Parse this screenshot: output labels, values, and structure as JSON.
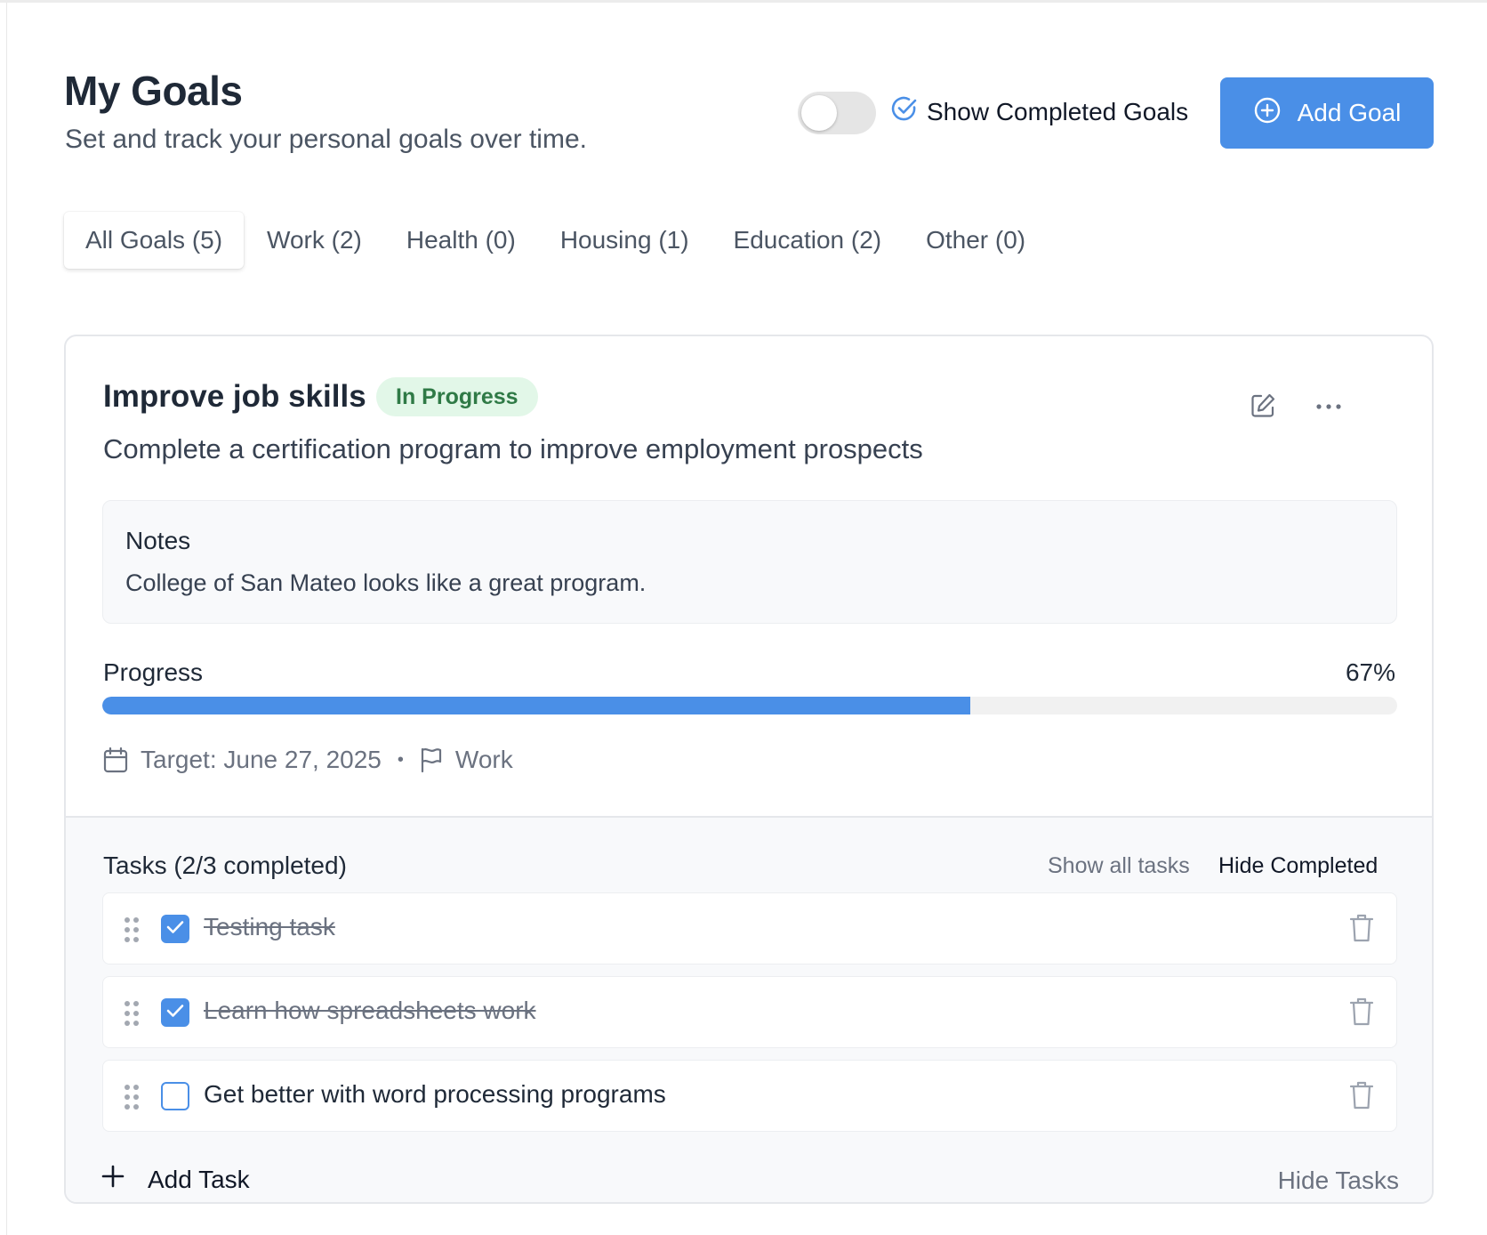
{
  "header": {
    "title": "My Goals",
    "subtitle": "Set and track your personal goals over time.",
    "toggle_on": false,
    "show_completed_label": "Show Completed Goals",
    "add_goal_label": "Add Goal"
  },
  "tabs": [
    {
      "label": "All Goals (5)",
      "active": true
    },
    {
      "label": "Work (2)",
      "active": false
    },
    {
      "label": "Health (0)",
      "active": false
    },
    {
      "label": "Housing (1)",
      "active": false
    },
    {
      "label": "Education (2)",
      "active": false
    },
    {
      "label": "Other (0)",
      "active": false
    }
  ],
  "goal": {
    "title": "Improve job skills",
    "status": "In Progress",
    "description": "Complete a certification program to improve employment prospects",
    "notes_label": "Notes",
    "notes_text": "College of San Mateo looks like a great program.",
    "progress_label": "Progress",
    "progress_text": "67%",
    "progress_fraction": 0.67,
    "target": "Target: June 27, 2025",
    "separator": "•",
    "category": "Work"
  },
  "tasks": {
    "title": "Tasks (2/3 completed)",
    "show_all_label": "Show all tasks",
    "hide_completed_label": "Hide Completed",
    "items": [
      {
        "text": "Testing task",
        "completed": true
      },
      {
        "text": "Learn how spreadsheets work",
        "completed": true
      },
      {
        "text": "Get better with word processing programs",
        "completed": false
      }
    ],
    "add_task_label": "Add Task",
    "hide_tasks_label": "Hide Tasks"
  },
  "colors": {
    "accent": "#4a8fe7",
    "badge_bg": "#e2f7e8",
    "badge_text": "#2f7a46"
  }
}
